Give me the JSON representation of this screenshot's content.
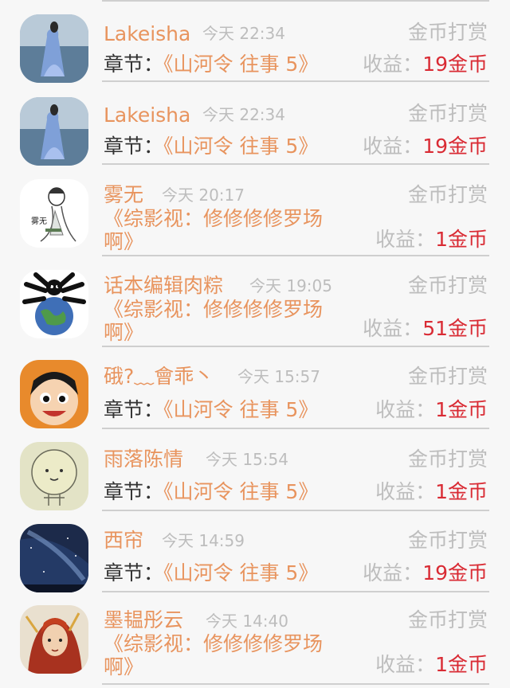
{
  "colors": {
    "background": "#f7f7f7",
    "name": "#e8945e",
    "book": "#e8945e",
    "muted": "#bdbdbd",
    "label": "#333333",
    "amount": "#d92b34",
    "separator": "#cfcfcf"
  },
  "records": [
    {
      "avatar": "woman-blue-dress-sea-avatar",
      "name": "Lakeisha",
      "time": "今天 22:34",
      "type": "金币打赏",
      "chapter_label": "章节：",
      "book": "《山河令 往事 5》",
      "income_label": "收益：",
      "amount": "19金币"
    },
    {
      "avatar": "woman-blue-dress-sea-avatar",
      "name": "Lakeisha",
      "time": "今天 22:34",
      "type": "金币打赏",
      "chapter_label": "章节：",
      "book": "《山河令 往事 5》",
      "income_label": "收益：",
      "amount": "19金币"
    },
    {
      "avatar": "ink-sketch-figure-avatar",
      "name": "雾无",
      "time": "今天 20:17",
      "type": "金币打赏",
      "book_line1": "《综影视：修修修修罗场",
      "book_line2": "啊》",
      "income_label": "收益：",
      "amount": "1金币"
    },
    {
      "avatar": "bone-creature-earth-avatar",
      "name": "话本编辑肉粽",
      "time": "今天 19:05",
      "type": "金币打赏",
      "book_line1": "《综影视：修修修修罗场",
      "book_line2": "啊》",
      "income_label": "收益：",
      "amount": "51金币"
    },
    {
      "avatar": "luffy-cartoon-avatar",
      "name": "硪?﹏會乖丶",
      "time": "今天 15:57",
      "type": "金币打赏",
      "chapter_label": "章节：",
      "book": "《山河令 往事 5》",
      "income_label": "收益：",
      "amount": "1金币"
    },
    {
      "avatar": "round-face-doodle-avatar",
      "name": "雨落陈情",
      "time": "今天 15:54",
      "type": "金币打赏",
      "chapter_label": "章节：",
      "book": "《山河令 往事 5》",
      "income_label": "收益：",
      "amount": "1金币"
    },
    {
      "avatar": "starry-night-sky-avatar",
      "name": "西帘",
      "time": "今天 14:59",
      "type": "金币打赏",
      "chapter_label": "章节：",
      "book": "《山河令 往事 5》",
      "income_label": "收益：",
      "amount": "19金币"
    },
    {
      "avatar": "red-haired-anime-character-avatar",
      "name": "墨韫彤云",
      "time": "今天 14:40",
      "type": "金币打赏",
      "book_line1": "《综影视：修修修修罗场",
      "book_line2": "啊》",
      "income_label": "收益：",
      "amount": "1金币"
    }
  ]
}
